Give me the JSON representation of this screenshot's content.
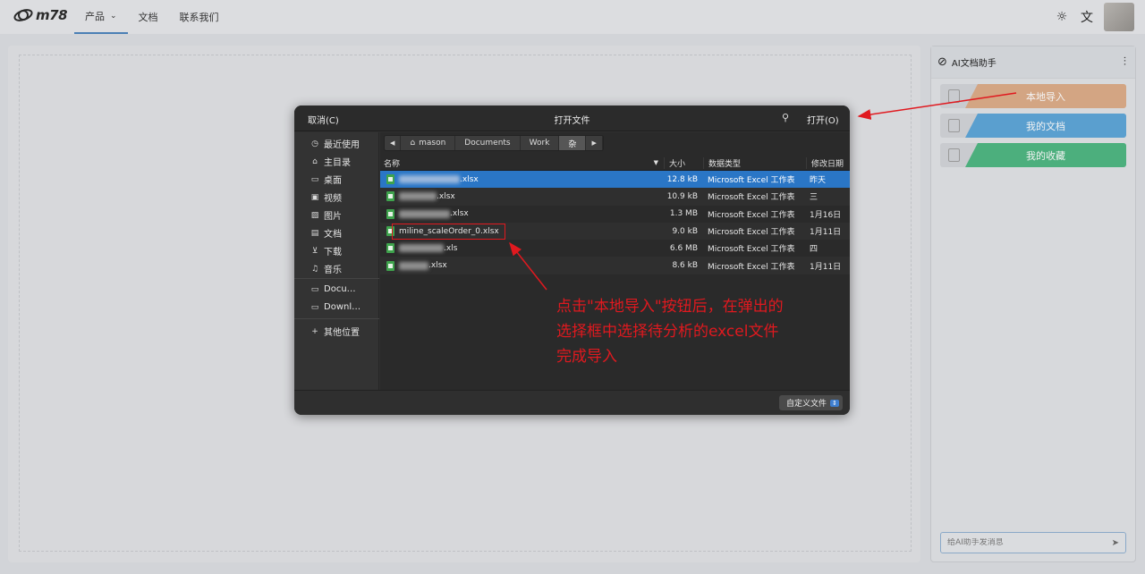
{
  "app": {
    "logo_text": "m78",
    "nav": [
      {
        "label": "产品",
        "has_dropdown": true,
        "active": true
      },
      {
        "label": "文档"
      },
      {
        "label": "联系我们"
      }
    ],
    "theme_icon": "sun-icon",
    "translate_icon": "translate-icon"
  },
  "ai_panel": {
    "title": "AI文档助手",
    "buttons": [
      {
        "label": "本地导入",
        "color": "#d3a583"
      },
      {
        "label": "我的文档",
        "color": "#5a9fcf"
      },
      {
        "label": "我的收藏",
        "color": "#4caf7d"
      }
    ],
    "input_placeholder": "给AI助手发消息"
  },
  "dialog": {
    "cancel_label": "取消(C)",
    "title": "打开文件",
    "open_label": "打开(O)",
    "sidebar": [
      {
        "label": "最近使用",
        "icon": "clock-icon"
      },
      {
        "label": "主目录",
        "icon": "home-icon"
      },
      {
        "label": "桌面",
        "icon": "desktop-icon"
      },
      {
        "label": "视频",
        "icon": "video-icon"
      },
      {
        "label": "图片",
        "icon": "image-icon"
      },
      {
        "label": "文档",
        "icon": "document-icon"
      },
      {
        "label": "下载",
        "icon": "download-icon"
      },
      {
        "label": "音乐",
        "icon": "music-icon"
      },
      {
        "label": "Docu…",
        "icon": "folder-icon"
      },
      {
        "label": "Downl…",
        "icon": "folder-icon"
      },
      {
        "label": "其他位置",
        "icon": "plus-icon"
      }
    ],
    "breadcrumb": [
      "mason",
      "Documents",
      "Work",
      "杂"
    ],
    "columns": {
      "name": "名称",
      "size": "大小",
      "type": "数据类型",
      "date": "修改日期"
    },
    "files": [
      {
        "suffix": ".xlsx",
        "size": "12.8 kB",
        "type": "Microsoft Excel 工作表",
        "date": "昨天",
        "selected": true
      },
      {
        "suffix": ".xlsx",
        "size": "10.9 kB",
        "type": "Microsoft Excel 工作表",
        "date": "三"
      },
      {
        "suffix": ".xlsx",
        "size": "1.3 MB",
        "type": "Microsoft Excel 工作表",
        "date": "1月16日"
      },
      {
        "name": "miline_scaleOrder_0.xlsx",
        "size": "9.0 kB",
        "type": "Microsoft Excel 工作表",
        "date": "1月11日",
        "highlighted": true
      },
      {
        "suffix": ".xls",
        "size": "6.6 MB",
        "type": "Microsoft Excel 工作表",
        "date": "四"
      },
      {
        "suffix": ".xlsx",
        "size": "8.6 kB",
        "type": "Microsoft Excel 工作表",
        "date": "1月11日"
      }
    ],
    "filter_label": "自定义文件"
  },
  "annotation": {
    "lines": [
      "点击\"本地导入\"按钮后，在弹出的",
      "选择框中选择待分析的excel文件",
      "完成导入"
    ]
  }
}
